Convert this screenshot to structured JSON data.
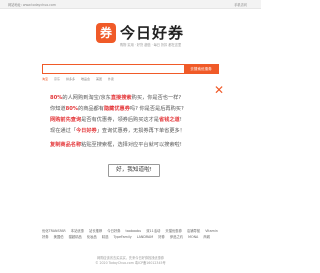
{
  "topbar": {
    "left": "网站地址: www.todaychuo.com",
    "right": "手机访问"
  },
  "logo": {
    "badge": "券",
    "name": "今日好券",
    "slogan": "购物 实用 · 好货 超值 · 每日 折扣 都在这里"
  },
  "search": {
    "placeholder": "",
    "button": "去搜索优惠券",
    "tabs": [
      "淘宝",
      "京东",
      "拼多多",
      "唯品会",
      "美团",
      "外卖"
    ]
  },
  "dialog": {
    "line1": {
      "a": "80%",
      "b": "的人网购到淘宝/京东",
      "c": "直接搜索",
      "d": "购买，你是否也一样?"
    },
    "line2": {
      "a": "你知道",
      "b": "80%",
      "c": "的商品都有",
      "d": "隐藏优惠券",
      "e": "吗? 你是否是后再购买?"
    },
    "line3": {
      "a": "网购前先查询",
      "b": "是否有优惠券，领券后购买这才是",
      "c": "省钱之道",
      "d": "!"
    },
    "line4": {
      "a": "现在通过「",
      "b": "今日好券",
      "c": "」查询优惠券，无损券再下单省更多！"
    },
    "line5": {
      "a": "复制商品名称",
      "b": "粘贴至搜索框，选择对应平台就可以搜索啦!"
    },
    "ok_button": "好，我知道啦!",
    "close_glyph": "✕"
  },
  "links": [
    "优化TRANSFAR",
    "本站优惠",
    "站长推荐",
    "今日好券",
    "taobaobu",
    "双11活动",
    "天猫优惠券",
    "店铺导航",
    "Vitamin",
    "好券",
    "美国伯",
    "猫超精品",
    "化妆品",
    "精选",
    "TypeFamily",
    "LANDRAM",
    "好券",
    "伊品之约",
    "MONA",
    "商城"
  ],
  "footer": {
    "line1": "网购应该省去买买买，先来今日好券找找优惠券",
    "line2": "© 2020 TodayChuo.com 粤ICP备16012345号"
  }
}
